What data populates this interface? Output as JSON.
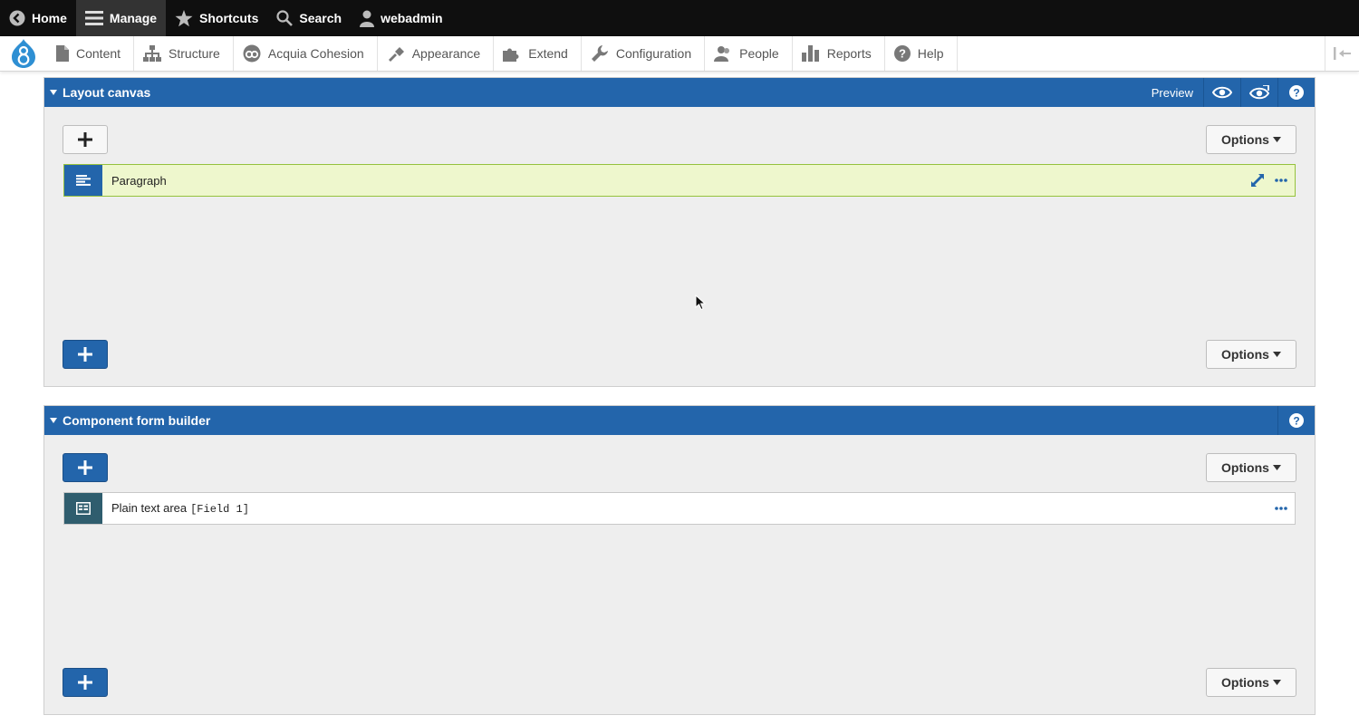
{
  "toolbar": {
    "home": "Home",
    "manage": "Manage",
    "shortcuts": "Shortcuts",
    "search": "Search",
    "user": "webadmin"
  },
  "admin_menu": {
    "items": [
      {
        "label": "Content",
        "icon": "page-icon"
      },
      {
        "label": "Structure",
        "icon": "sitemap-icon"
      },
      {
        "label": "Acquia Cohesion",
        "icon": "cohesion-icon"
      },
      {
        "label": "Appearance",
        "icon": "brush-icon"
      },
      {
        "label": "Extend",
        "icon": "puzzle-icon"
      },
      {
        "label": "Configuration",
        "icon": "wrench-icon"
      },
      {
        "label": "People",
        "icon": "people-icon"
      },
      {
        "label": "Reports",
        "icon": "bar-chart-icon"
      },
      {
        "label": "Help",
        "icon": "help-icon"
      }
    ]
  },
  "layout_canvas": {
    "title": "Layout canvas",
    "preview_label": "Preview",
    "options_label": "Options",
    "items": [
      {
        "label": "Paragraph",
        "icon": "paragraph-icon"
      }
    ]
  },
  "form_builder": {
    "title": "Component form builder",
    "options_label": "Options",
    "items": [
      {
        "label": "Plain text area",
        "field": "[Field 1]",
        "icon": "textarea-icon"
      }
    ]
  },
  "colors": {
    "panel_header": "#2365ab",
    "highlight_row": "#eef7cd",
    "toolbar": "#0f0f0f"
  }
}
